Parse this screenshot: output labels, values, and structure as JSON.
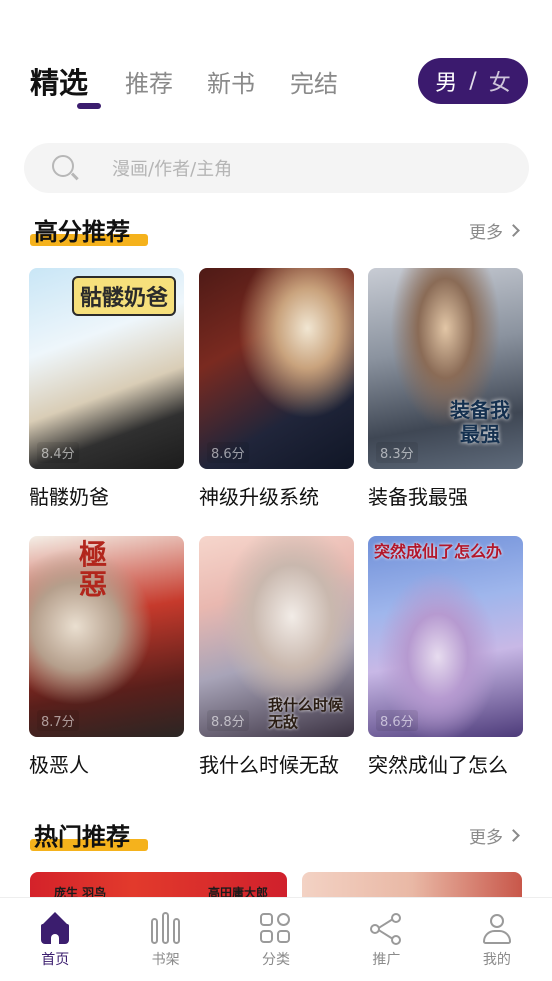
{
  "top_tabs": {
    "items": [
      {
        "label": "精选",
        "active": true
      },
      {
        "label": "推荐",
        "active": false
      },
      {
        "label": "新书",
        "active": false
      },
      {
        "label": "完结",
        "active": false
      }
    ],
    "gender_toggle": {
      "male": "男",
      "separator": "/",
      "female": "女"
    }
  },
  "search": {
    "placeholder": "漫画/作者/主角"
  },
  "sections": {
    "high_score": {
      "title": "高分推荐",
      "more": "更多"
    },
    "hot": {
      "title": "热门推荐",
      "more": "更多"
    }
  },
  "comics": [
    {
      "title": "骷髅奶爸",
      "score": "8.4分",
      "cover_text": "骷髅奶爸"
    },
    {
      "title": "神级升级系统",
      "score": "8.6分",
      "cover_text": ""
    },
    {
      "title": "装备我最强",
      "score": "8.3分",
      "cover_text": "装备我最强"
    },
    {
      "title": "极恶人",
      "score": "8.7分",
      "cover_text": "極惡"
    },
    {
      "title": "我什么时候无敌",
      "score": "8.8分",
      "cover_text": "我什么时候无敌"
    },
    {
      "title": "突然成仙了怎么",
      "score": "8.6分",
      "cover_text": "突然成仙了怎么办"
    }
  ],
  "hot_covers": [
    {
      "text_left": "庞生 羽鸟",
      "text_right": "高田庸大郎"
    },
    {}
  ],
  "bottom_nav": [
    {
      "label": "首页",
      "icon": "home-icon",
      "active": true
    },
    {
      "label": "书架",
      "icon": "bookshelf-icon",
      "active": false
    },
    {
      "label": "分类",
      "icon": "category-icon",
      "active": false
    },
    {
      "label": "推广",
      "icon": "share-icon",
      "active": false
    },
    {
      "label": "我的",
      "icon": "person-icon",
      "active": false
    }
  ],
  "colors": {
    "accent": "#3b1d6e",
    "highlight": "#f5b21c",
    "muted": "#8a8a8a"
  }
}
